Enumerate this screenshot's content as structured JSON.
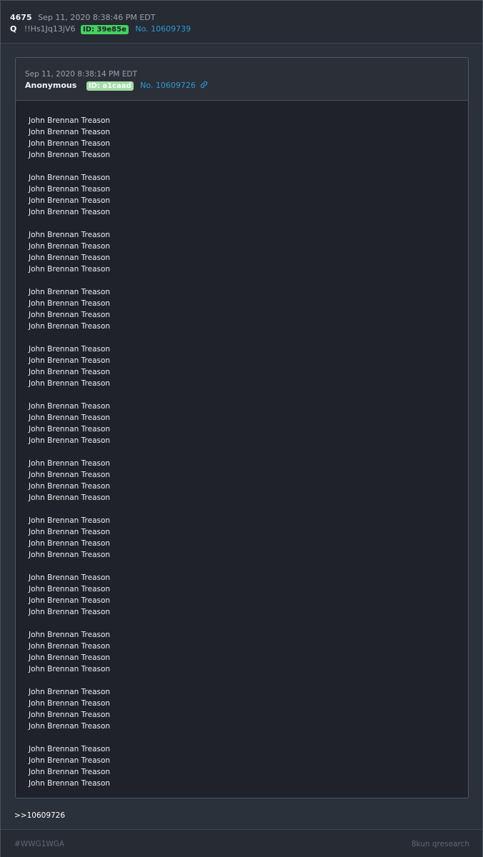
{
  "post": {
    "number": "4675",
    "date": "Sep 11, 2020 8:38:46 PM EDT",
    "author": "Q",
    "tripcode": "!!Hs1Jq13jV6",
    "id_badge": "ID: 39e85e",
    "post_link": "No. 10609739"
  },
  "quoted_post": {
    "date": "Sep 11, 2020 8:38:14 PM EDT",
    "author": "Anonymous",
    "id_badge": "ID: a1caad",
    "post_link": "No. 10609726",
    "lines": [
      [
        "John Brennan Treason",
        "John Brennan Treason",
        "John Brennan Treason",
        "John Brennan Treason"
      ],
      [
        "John Brennan Treason",
        "John Brennan Treason",
        "John Brennan Treason",
        "John Brennan Treason"
      ],
      [
        "John Brennan Treason",
        "John Brennan Treason",
        "John Brennan Treason",
        "John Brennan Treason"
      ],
      [
        "John Brennan Treason",
        "John Brennan Treason",
        "John Brennan Treason",
        "John Brennan Treason"
      ],
      [
        "John Brennan Treason",
        "John Brennan Treason",
        "John Brennan Treason",
        "John Brennan Treason"
      ],
      [
        "John Brennan Treason",
        "John Brennan Treason",
        "John Brennan Treason",
        "John Brennan Treason"
      ],
      [
        "John Brennan Treason",
        "John Brennan Treason",
        "John Brennan Treason",
        "John Brennan Treason"
      ],
      [
        "John Brennan Treason",
        "John Brennan Treason",
        "John Brennan Treason",
        "John Brennan Treason"
      ],
      [
        "John Brennan Treason",
        "John Brennan Treason",
        "John Brennan Treason",
        "John Brennan Treason"
      ],
      [
        "John Brennan Treason",
        "John Brennan Treason",
        "John Brennan Treason",
        "John Brennan Treason"
      ],
      [
        "John Brennan Treason",
        "John Brennan Treason",
        "John Brennan Treason",
        "John Brennan Treason"
      ],
      [
        "John Brennan Treason",
        "John Brennan Treason",
        "John Brennan Treason",
        "John Brennan Treason"
      ]
    ]
  },
  "reply": {
    "text": ">>10609726"
  },
  "footer": {
    "hashtag": "#WWG1WGA",
    "source": "8kun qresearch"
  },
  "icons": {
    "quoted_link_icon": "chain-link-icon"
  },
  "colors": {
    "background": "#2b313b",
    "header_bg": "#262b34",
    "quoted_bg": "#1f222a",
    "link": "#2f9ad6",
    "id_badge_green": "#46d160",
    "id_badge_pale": "#a5dba8"
  }
}
